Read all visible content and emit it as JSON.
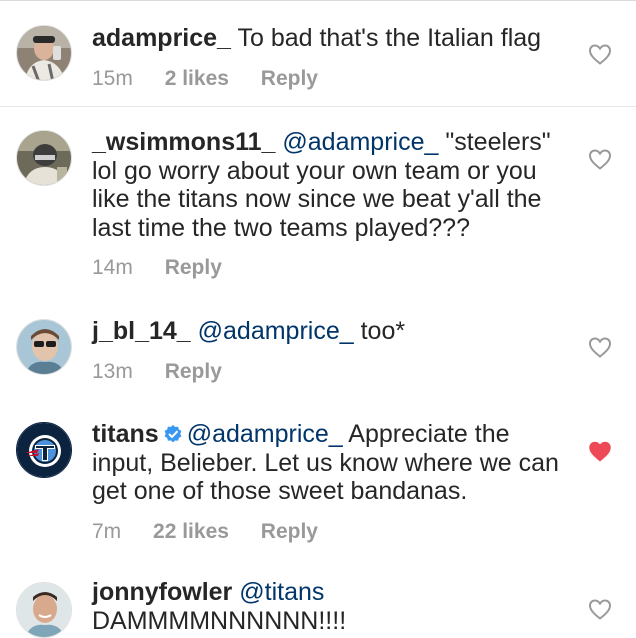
{
  "comments": [
    {
      "username": "adamprice_",
      "text": "To bad that's the Italian flag",
      "time": "15m",
      "likes": "2 likes",
      "reply": "Reply",
      "liked": false,
      "avatar": "person-selfie"
    },
    {
      "username": "_wsimmons11_",
      "mention": "@adamprice_",
      "text": "\"steelers\" lol go worry about your own team or you like the titans now since we beat y'all the last time the two teams played???",
      "time": "14m",
      "reply": "Reply",
      "liked": false,
      "avatar": "person-helmet"
    },
    {
      "username": "j_bl_14_",
      "mention": "@adamprice_",
      "text": "too*",
      "time": "13m",
      "reply": "Reply",
      "liked": false,
      "avatar": "person-sunglasses"
    },
    {
      "username": "titans",
      "verified": true,
      "mention": "@adamprice_",
      "text": "Appreciate the input, Belieber. Let us know where we can get one of those sweet bandanas.",
      "time": "7m",
      "likes": "22 likes",
      "reply": "Reply",
      "liked": true,
      "avatar": "titans-logo"
    },
    {
      "username": "jonnyfowler",
      "mention": "@titans",
      "text": "DAMMMMNNNNNN!!!!",
      "liked": false,
      "avatar": "person-smiling"
    }
  ],
  "icons": {
    "heart_empty": "heart-outline-icon",
    "heart_filled": "heart-filled-icon",
    "verified": "verified-badge-icon"
  },
  "colors": {
    "text": "#262626",
    "mention": "#003569",
    "meta": "#999999",
    "liked_heart": "#ed4956",
    "verified_badge": "#3897f0",
    "titans_navy": "#0c2340"
  }
}
